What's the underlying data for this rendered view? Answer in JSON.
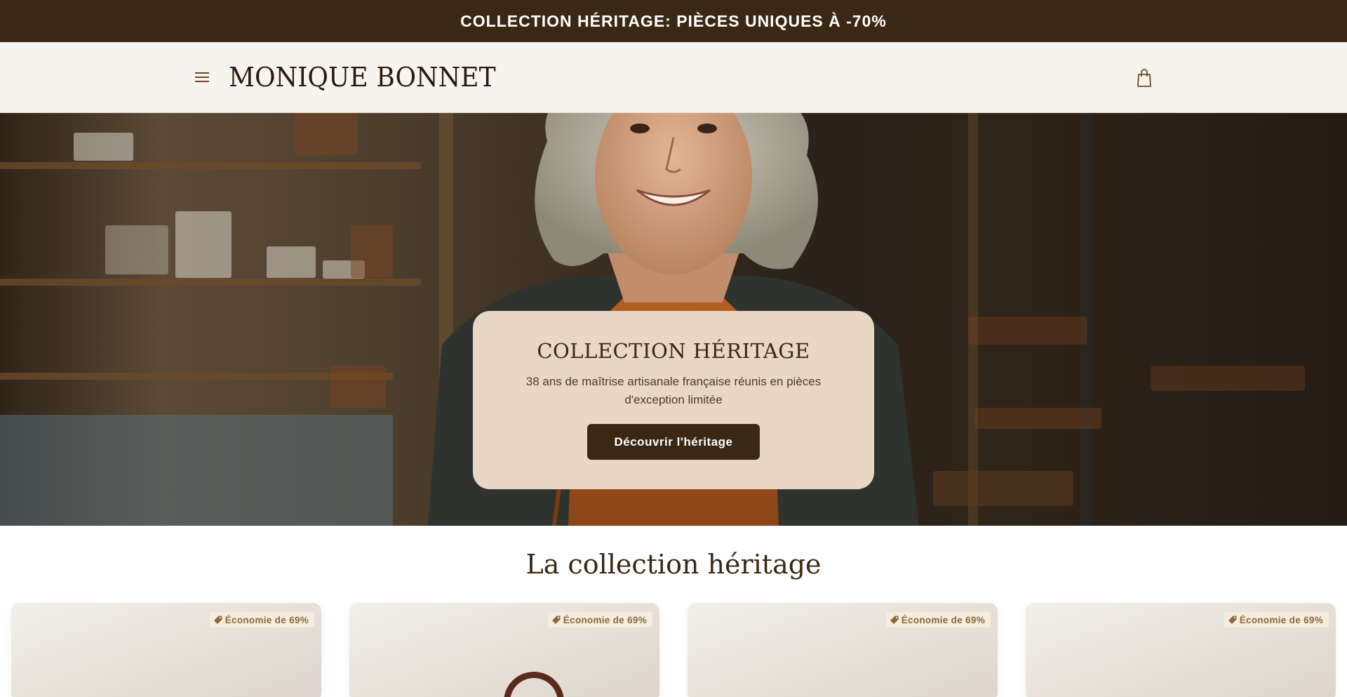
{
  "announcement": "COLLECTION HÉRITAGE: PIÈCES UNIQUES À -70%",
  "header": {
    "logo": "MONIQUE BONNET",
    "menu_icon": "hamburger-menu-icon",
    "cart_icon": "shopping-bag-icon"
  },
  "hero": {
    "title": "COLLECTION HÉRITAGE",
    "subtitle": "38 ans de maîtrise artisanale française réunis en pièces d'exception limitée",
    "cta": "Découvrir l'héritage"
  },
  "section": {
    "title": "La collection héritage"
  },
  "products": [
    {
      "badge": "Économie de 69%"
    },
    {
      "badge": "Économie de 69%"
    },
    {
      "badge": "Économie de 69%"
    },
    {
      "badge": "Économie de 69%"
    }
  ],
  "colors": {
    "brand_dark": "#3b2814",
    "card_beige": "#e8d8c3",
    "header_bg": "#f7f3ef",
    "badge_text": "#8a6a3a"
  }
}
